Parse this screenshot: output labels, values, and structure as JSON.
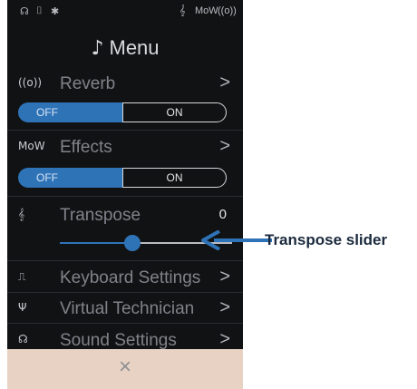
{
  "status": {
    "headphones": "☊",
    "usb": "⌷",
    "bluetooth": "✱",
    "transpose": "𝄞",
    "effects": "MoW",
    "reverb": "((o))"
  },
  "menu": {
    "note_icon": "♪",
    "title": "Menu",
    "items": [
      {
        "icon": "((o))",
        "label": "Reverb",
        "chevron": ">",
        "toggle": {
          "off_label": "OFF",
          "on_label": "ON",
          "selected": "OFF"
        }
      },
      {
        "icon": "MoW",
        "label": "Effects",
        "chevron": ">",
        "toggle": {
          "off_label": "OFF",
          "on_label": "ON",
          "selected": "OFF"
        }
      },
      {
        "icon": "𝄞",
        "label": "Transpose",
        "value": "0"
      },
      {
        "icon": "⎍",
        "label": "Keyboard Settings",
        "chevron": ">"
      },
      {
        "icon": "Ψ",
        "label": "Virtual Technician",
        "chevron": ">"
      },
      {
        "icon": "☊",
        "label": "Sound Settings",
        "chevron": ">"
      }
    ]
  },
  "slider": {
    "position": 0.42
  },
  "bottom": {
    "close": "×"
  },
  "callout": {
    "label": "Transpose slider"
  },
  "colors": {
    "accent": "#2f73b7",
    "panel": "#111214",
    "bottom_bar": "#e7d2c3",
    "callout_text": "#1b2a3d"
  }
}
